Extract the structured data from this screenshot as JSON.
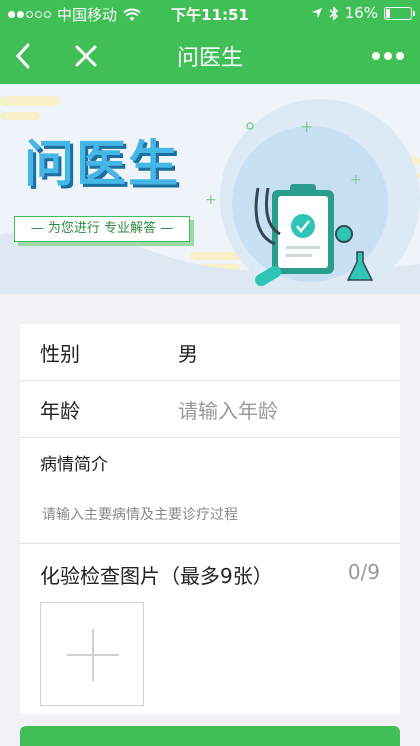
{
  "status_bar": {
    "carrier": "中国移动",
    "time": "下午11:51",
    "battery_text": "16%",
    "battery_level": 0.16,
    "signal_dots": [
      true,
      true,
      false,
      false,
      false
    ]
  },
  "nav": {
    "title": "问医生",
    "back_icon": "chevron-left-icon",
    "close_icon": "close-icon",
    "more_icon": "more-dots-icon"
  },
  "banner": {
    "title": "问医生",
    "subtitle": "— 为您进行 专业解答 —"
  },
  "form": {
    "gender_label": "性别",
    "gender_value": "男",
    "age_label": "年龄",
    "age_placeholder": "请输入年龄",
    "desc_label": "病情简介",
    "desc_placeholder": "请输入主要病情及主要诊疗过程",
    "images_label": "化验检查图片（最多9张）",
    "images_count": "0/9"
  },
  "colors": {
    "brand_green": "#3fbf55",
    "banner_blue": "#45b6e6"
  }
}
